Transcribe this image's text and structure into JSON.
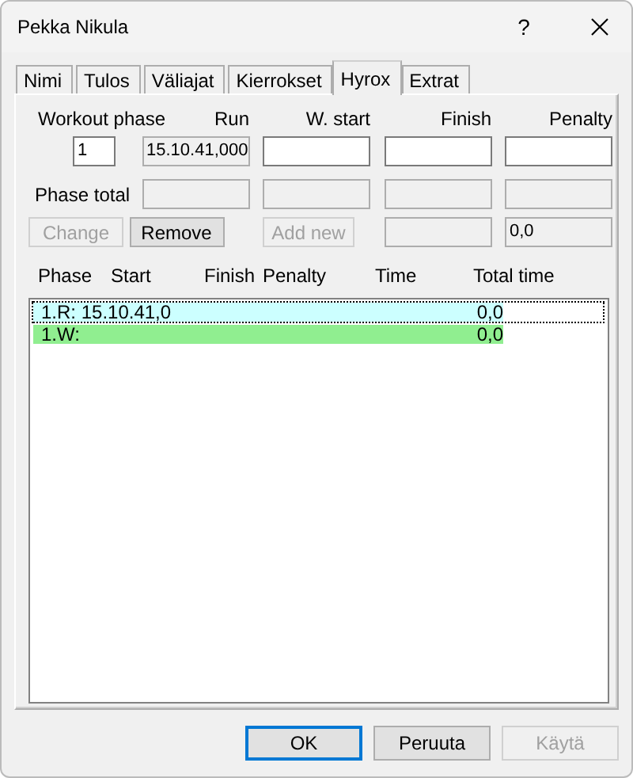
{
  "window": {
    "title": "Pekka Nikula",
    "help": "?"
  },
  "tabs": [
    {
      "label": "Nimi",
      "selected": false
    },
    {
      "label": "Tulos",
      "selected": false
    },
    {
      "label": "Väliajat",
      "selected": false
    },
    {
      "label": "Kierrokset",
      "selected": false
    },
    {
      "label": "Hyrox",
      "selected": true
    },
    {
      "label": "Extrat",
      "selected": false
    }
  ],
  "entry": {
    "headers": [
      "Workout phase",
      "Run",
      "W. start",
      "Finish",
      "Penalty"
    ],
    "fields": [
      {
        "value": "1",
        "disabled": false
      },
      {
        "value": "15.10.41,000",
        "disabled": true
      },
      {
        "disabled": false
      },
      {
        "disabled": false
      },
      {
        "disabled": false
      }
    ]
  },
  "phase_total": {
    "label": "Phase total",
    "fields": [
      {
        "disabled": true
      },
      {
        "disabled": true
      },
      {
        "disabled": true
      },
      {
        "disabled": true
      }
    ]
  },
  "actions": {
    "buttons": [
      {
        "label": "Change",
        "disabled": true
      },
      {
        "label": "Remove",
        "disabled": false
      },
      {
        "label": "Add new",
        "disabled": true
      }
    ],
    "fields": [
      {
        "disabled": true
      },
      {
        "value": "0,0",
        "disabled": true
      }
    ]
  },
  "list": {
    "columns": [
      "Phase",
      "Start",
      "Finish",
      "Penalty",
      "Time",
      "Total time"
    ],
    "rows": [
      {
        "text": "1.R: 15.10.41,0",
        "total": "0,0",
        "color": "#ccffff",
        "focused": true
      },
      {
        "text": "1.W:",
        "total": "0,0",
        "color": "#90ee90",
        "focused": false
      }
    ]
  },
  "dialog_buttons": [
    {
      "label": "OK",
      "default": true,
      "disabled": false
    },
    {
      "label": "Peruuta",
      "default": false,
      "disabled": false
    },
    {
      "label": "Käytä",
      "default": false,
      "disabled": true
    }
  ]
}
